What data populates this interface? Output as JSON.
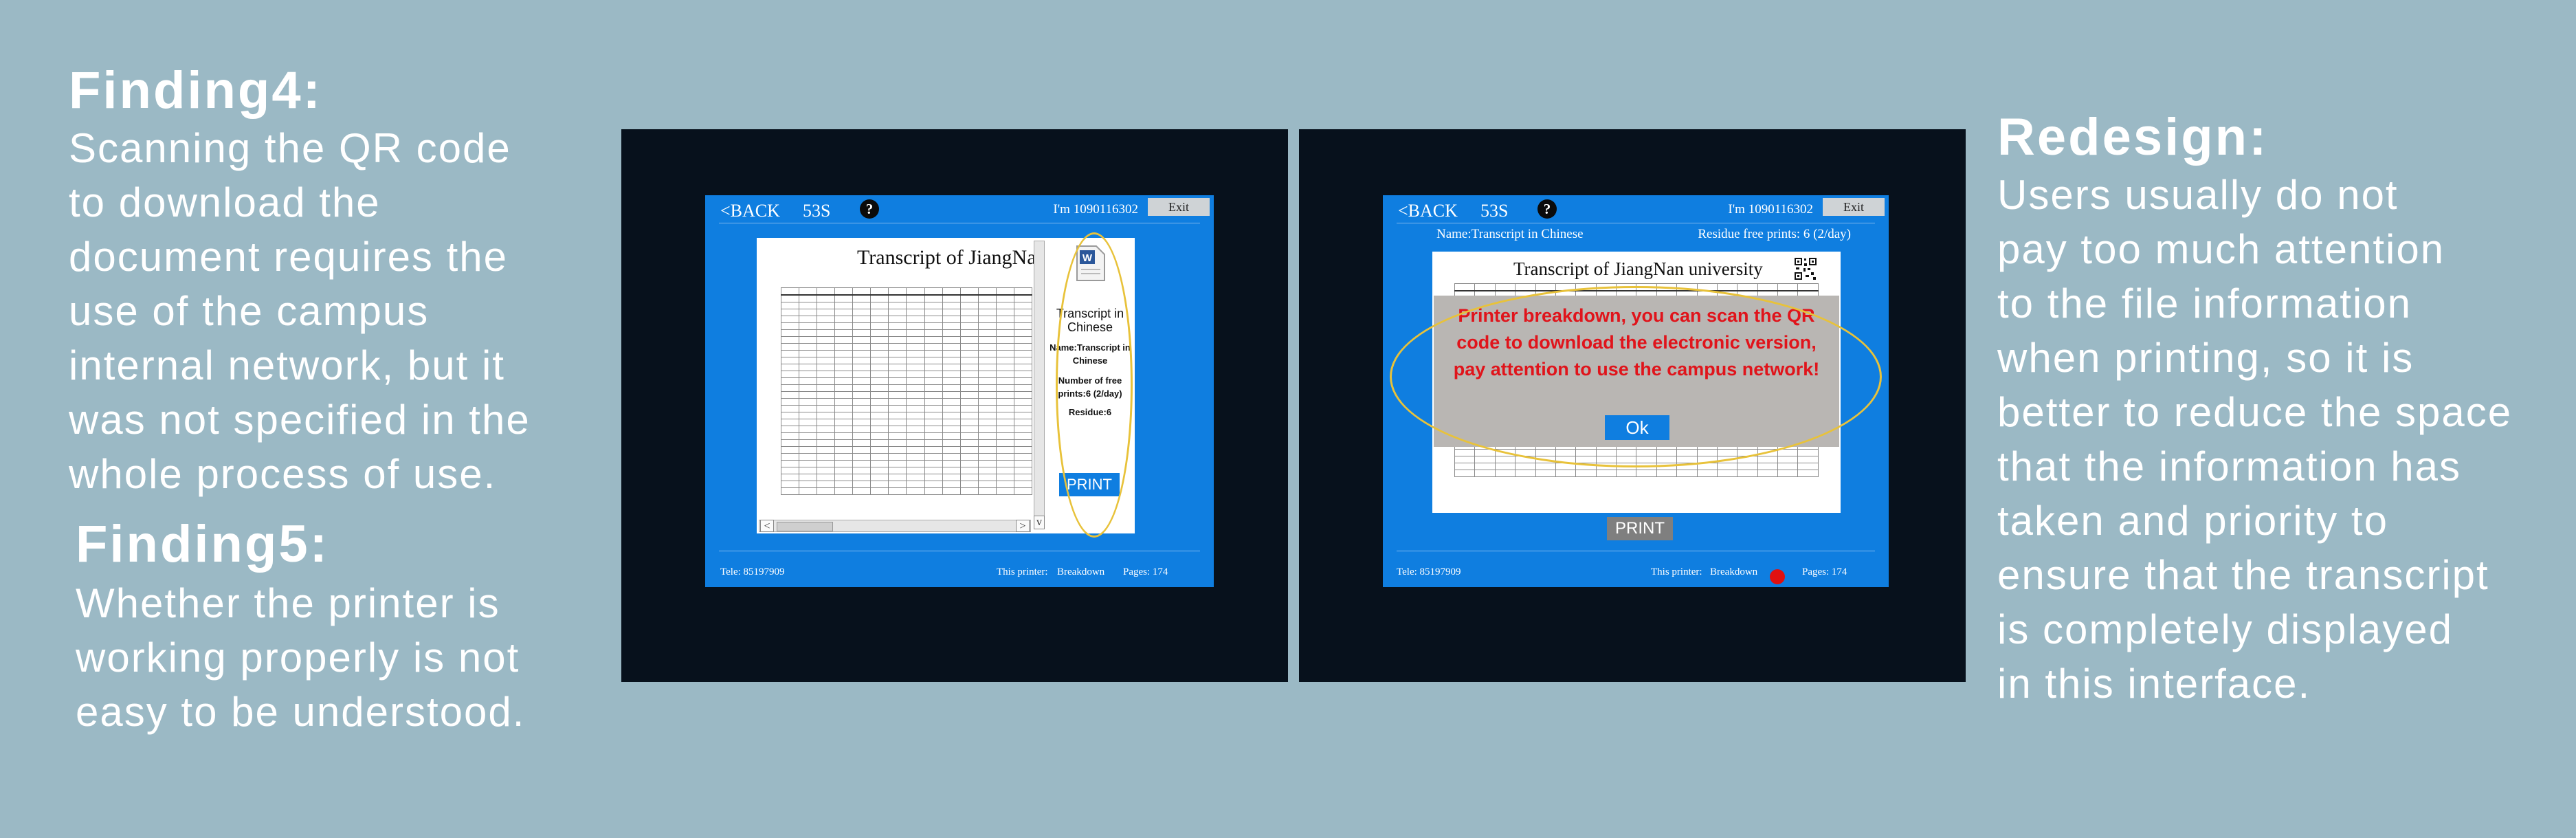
{
  "finding4": {
    "heading": "Finding4:",
    "body": "Scanning the QR code\nto download the\ndocument requires the\nuse of the campus\ninternal network, but it\nwas not specified in the\nwhole process of use."
  },
  "finding5": {
    "heading": "Finding5:",
    "body": "Whether the printer is\nworking properly is not\neasy to be understood."
  },
  "redesign": {
    "heading": "Redesign:",
    "body": "Users usually do not\npay too much attention\nto the file information\nwhen printing, so it is\nbetter to reduce the space\nthat the information has\ntaken and priority to\nensure that the transcript\nis completely displayed\nin this interface."
  },
  "colors": {
    "background": "#9bb9c5",
    "screen_blue": "#0f7ee0",
    "frame": "#07111c",
    "highlight": "#e8c23a",
    "alert_red": "#e0141b"
  },
  "icons": [
    "help-icon",
    "word-document-icon",
    "qr-code-icon",
    "status-red-dot-icon"
  ],
  "screen_left": {
    "back": "<BACK",
    "timer": "53S",
    "help": "?",
    "user": "I'm 1090116302",
    "exit": "Exit",
    "doc_title": "Transcript of JiangNa",
    "panel": {
      "file_title": "Transcript in Chinese",
      "name": "Name:Transcript in Chinese",
      "free_prints": "Number of free prints:6 (2/day)",
      "residue": "Residue:6"
    },
    "print": "PRINT",
    "tele": "Tele:  85197909",
    "printer_label": "This printer:",
    "printer_status": "Breakdown",
    "pages": "Pages:  174"
  },
  "screen_right": {
    "back": "<BACK",
    "timer": "53S",
    "help": "?",
    "user": "I'm 1090116302",
    "exit": "Exit",
    "name": "Name:Transcript in Chinese",
    "residue": "Residue free prints:  6 (2/day)",
    "doc_title": "Transcript of JiangNan university",
    "dialog_message": "Printer breakdown, you can scan the QR code to download the electronic version, pay attention to use the campus network!",
    "ok": "Ok",
    "print": "PRINT",
    "tele": "Tele:  85197909",
    "printer_label": "This printer:",
    "printer_status": "Breakdown",
    "pages": "Pages:  174"
  }
}
